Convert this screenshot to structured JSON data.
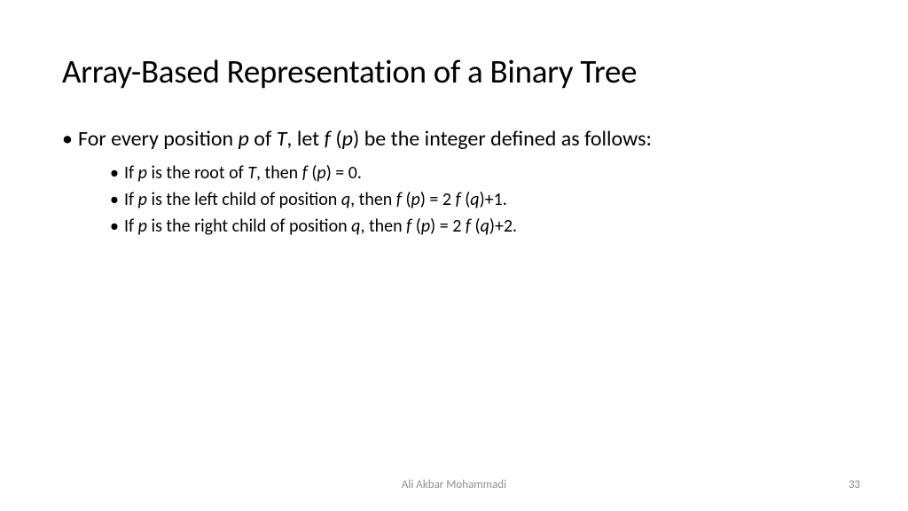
{
  "slide": {
    "title": "Array-Based Representation of a Binary Tree",
    "mainBullet": {
      "p1": "For every position ",
      "p2": "p",
      "p3": " of ",
      "p4": "T",
      "p5": ", let ",
      "p6": "f ",
      "p7": "(",
      "p8": "p",
      "p9": ") be the integer defined as follows:"
    },
    "sub1": {
      "a": "If ",
      "b": "p",
      "c": " is the root of ",
      "d": "T",
      "e": ", then ",
      "f": "f ",
      "g": "(",
      "h": "p",
      "i": ") = 0."
    },
    "sub2": {
      "a": "If ",
      "b": "p",
      "c": " is the left child of position ",
      "d": "q",
      "e": ", then ",
      "f": "f ",
      "g": "(",
      "h": "p",
      "i": ") = 2 ",
      "j": "f ",
      "k": "(",
      "l": "q",
      "m": ")+1."
    },
    "sub3": {
      "a": "If ",
      "b": "p",
      "c": " is the right child of position ",
      "d": "q",
      "e": ", then ",
      "f": "f ",
      "g": "(",
      "h": "p",
      "i": ") = 2 ",
      "j": "f ",
      "k": "(",
      "l": "q",
      "m": ")+2."
    },
    "footer": "Ali Akbar Mohammadi",
    "pageNumber": "33"
  }
}
